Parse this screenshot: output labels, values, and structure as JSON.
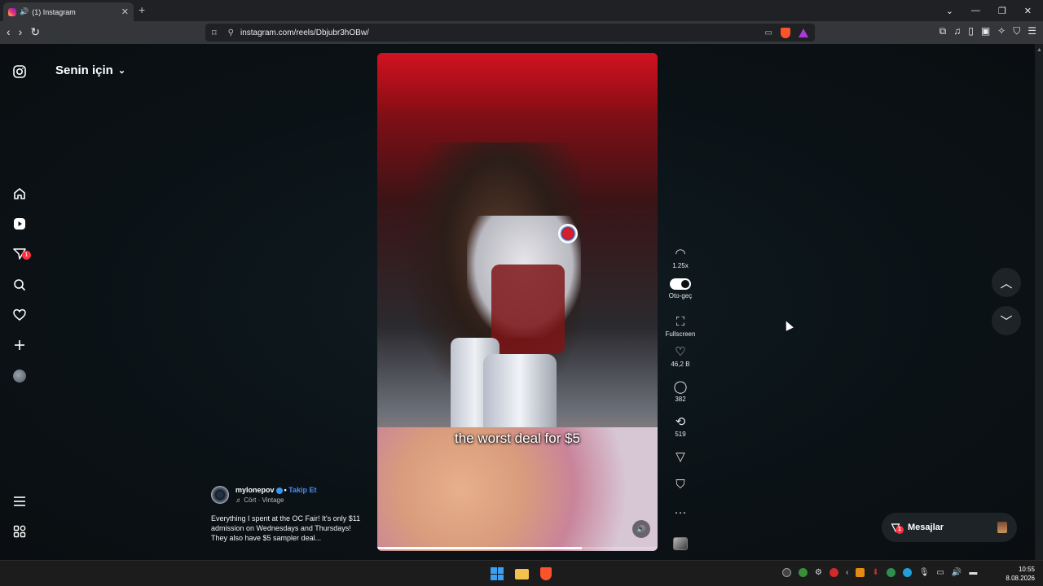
{
  "browser": {
    "tab_title": "(1) Instagram",
    "tab_close": "✕",
    "new_tab": "+",
    "url": "instagram.com/reels/Dbjubr3hOBw/",
    "window_controls": [
      "⌄",
      "—",
      "❐",
      "✕"
    ]
  },
  "sidebar": {
    "items": [
      {
        "name": "instagram-logo-icon"
      },
      {
        "name": "home-icon"
      },
      {
        "name": "reels-icon"
      },
      {
        "name": "messages-icon",
        "badge": "1"
      },
      {
        "name": "search-icon"
      },
      {
        "name": "notifications-icon"
      },
      {
        "name": "create-icon"
      },
      {
        "name": "profile-avatar"
      },
      {
        "name": "more-menu-icon"
      },
      {
        "name": "also-from-meta-icon"
      }
    ]
  },
  "feed": {
    "title": "Senin için"
  },
  "video": {
    "caption": "the worst deal for $5",
    "progress_fraction": 0.73
  },
  "actions": {
    "speed": "1.25x",
    "autoplay_label": "Oto-geç",
    "fullscreen_label": "Fullscreen",
    "likes": "46,2 B",
    "comments": "382",
    "reposts": "519"
  },
  "post": {
    "username": "mylonepov",
    "follow_label": "Takip Et",
    "audio": "Cört · Vintage",
    "description": "Everything I spent at the OC Fair! It's only $11 admission on Wednesdays and Thursdays! They also have $5 sampler deal..."
  },
  "messages": {
    "label": "Mesajlar",
    "badge": "1"
  },
  "taskbar": {
    "time": "10:55",
    "date": "8.08.2026"
  }
}
